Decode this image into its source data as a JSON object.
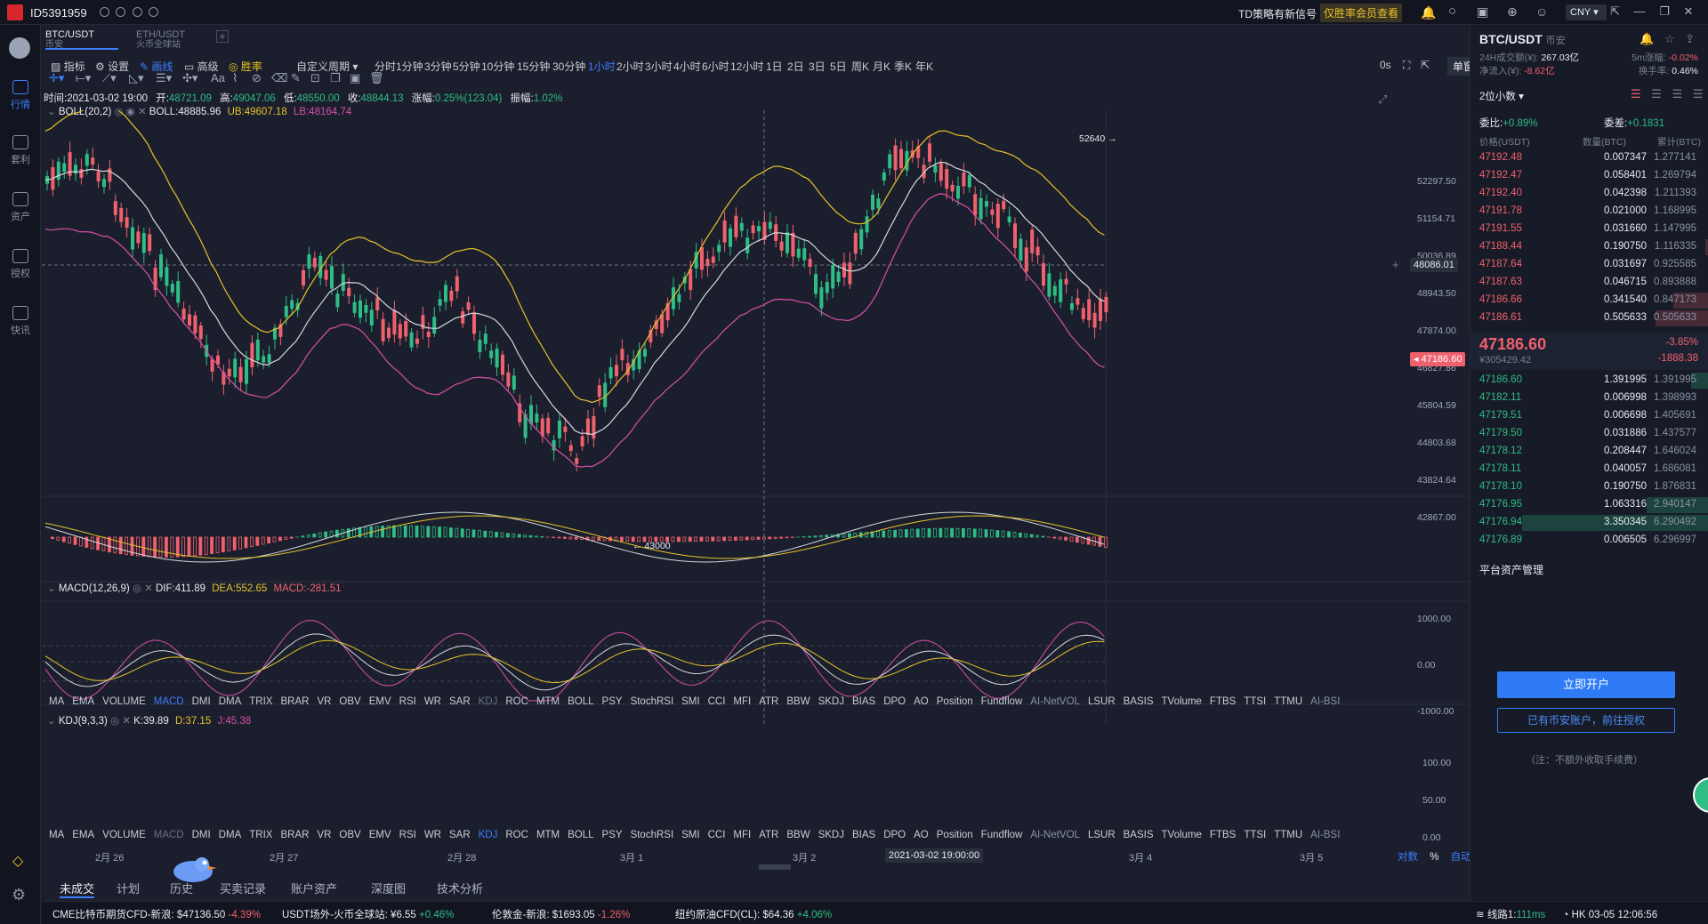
{
  "app": {
    "account_id": "ID5391959",
    "signal_text": "TD策略有新信号",
    "signal_link": "仅胜率会员查看",
    "currency": "CNY"
  },
  "nav": [
    {
      "label": "行情"
    },
    {
      "label": "套利"
    },
    {
      "label": "资产"
    },
    {
      "label": "授权"
    },
    {
      "label": "快讯"
    }
  ],
  "tabs": [
    {
      "title": "BTC/USDT",
      "sub": "币安"
    },
    {
      "title": "ETH/USDT",
      "sub": "火币全球站"
    }
  ],
  "toolbar": {
    "indicator": "指标",
    "settings": "设置",
    "draw": "画线",
    "advanced": "高级",
    "winrate": "胜率",
    "custom_period": "自定义周期",
    "periods": [
      "分时",
      "1分钟",
      "3分钟",
      "5分钟",
      "10分钟",
      "15分钟",
      "30分钟",
      "1小时",
      "2小时",
      "3小时",
      "4小时",
      "6小时",
      "12小时",
      "1日",
      "2日",
      "3日",
      "5日",
      "周K",
      "月K",
      "季K",
      "年K"
    ],
    "active_period": "1小时",
    "seconds": "0s",
    "window_mode": "单窗口"
  },
  "ohlc": {
    "time_label": "时间:",
    "time": "2021-03-02 19:00",
    "open_label": "开:",
    "open": "48721.09",
    "high_label": "高:",
    "high": "49047.06",
    "low_label": "低:",
    "low": "48550.00",
    "close_label": "收:",
    "close": "48844.13",
    "change_label": "涨幅:",
    "change": "0.25%(123.04)",
    "amp_label": "振幅:",
    "amp": "1.02%"
  },
  "boll": {
    "name": "BOLL(20,2)",
    "boll": "BOLL:48885.96",
    "ub": "UB:49607.18",
    "lb": "LB:48164.74"
  },
  "macd": {
    "name": "MACD(12,26,9)",
    "dif": "DIF:411.89",
    "dea": "DEA:552.65",
    "macd": "MACD:-281.51"
  },
  "kdj": {
    "name": "KDJ(9,3,3)",
    "k": "K:39.89",
    "d": "D:37.15",
    "j": "J:45.38"
  },
  "price_axis": [
    "52297.50",
    "51154.71",
    "50036.89",
    "48943.50",
    "47874.00",
    "46827.86",
    "45804.59",
    "44803.68",
    "43824.64",
    "42867.00"
  ],
  "crosshair_price": "48086.01",
  "last_price_tag": "47186.60",
  "high_mark": "52640",
  "low_mark": "43000",
  "macd_axis": [
    "1000.00",
    "0.00",
    "-1000.00"
  ],
  "kdj_axis": [
    "100.00",
    "50.00",
    "0.00"
  ],
  "indicator_list": [
    "MA",
    "EMA",
    "VOLUME",
    "MACD",
    "DMI",
    "DMA",
    "TRIX",
    "BRAR",
    "VR",
    "OBV",
    "EMV",
    "RSI",
    "WR",
    "SAR",
    "KDJ",
    "ROC",
    "MTM",
    "BOLL",
    "PSY",
    "StochRSI",
    "SMI",
    "CCI",
    "MFI",
    "ATR",
    "BBW",
    "SKDJ",
    "BIAS",
    "DPO",
    "AO",
    "Position",
    "Fundflow",
    "AI-NetVOL",
    "LSUR",
    "BASIS",
    "TVolume",
    "FTBS",
    "TTSI",
    "TTMU",
    "AI-BSI"
  ],
  "date_axis": [
    "2月 26",
    "2月 27",
    "2月 28",
    "3月 1",
    "3月 2",
    "3月 4",
    "3月 5"
  ],
  "crosshair_time": "2021-03-02 19:00:00",
  "axis_modes": [
    "对数",
    "%",
    "自动"
  ],
  "bottom_tabs": [
    "未成交",
    "计划",
    "历史",
    "买卖记录",
    "账户资产",
    "深度图",
    "技术分析"
  ],
  "ticker": [
    {
      "name": "CME比特币期货CFD-新浪:",
      "price": "$47136.50",
      "chg": "-4.39%",
      "dir": "down"
    },
    {
      "name": "USDT场外-火币全球站:",
      "price": "¥6.55",
      "chg": "+0.46%",
      "dir": "up"
    },
    {
      "name": "伦敦金-新浪:",
      "price": "$1693.05",
      "chg": "-1.26%",
      "dir": "down"
    },
    {
      "name": "纽约原油CFD(CL):",
      "price": "$64.36",
      "chg": "+4.06%",
      "dir": "up"
    }
  ],
  "connection": {
    "line": "线路1:",
    "ms": "111ms",
    "clock": "HK 03-05 12:06:56"
  },
  "panel": {
    "pair": "BTC/USDT",
    "exchange": "币安",
    "vol_label": "24H成交额(¥):",
    "vol": "267.03亿",
    "inflow_label": "净流入(¥):",
    "inflow": "-8.62亿",
    "amp5_label": "5m涨幅:",
    "amp5": "-0.02%",
    "turnover_label": "换手率:",
    "turnover": "0.46%",
    "decimals": "2位小数",
    "ratio_label": "委比:",
    "ratio": "+0.89%",
    "diff_label": "委差:",
    "diff": "+0.1831",
    "col_price": "价格(USDT)",
    "col_qty": "数量(BTC)",
    "col_cum": "累计(BTC)",
    "asks": [
      {
        "p": "47192.48",
        "q": "0.007347",
        "c": "1.277141",
        "w": 0
      },
      {
        "p": "47192.47",
        "q": "0.058401",
        "c": "1.269794",
        "w": 0
      },
      {
        "p": "47192.40",
        "q": "0.042398",
        "c": "1.211393",
        "w": 0
      },
      {
        "p": "47191.78",
        "q": "0.021000",
        "c": "1.168995",
        "w": 0
      },
      {
        "p": "47191.55",
        "q": "0.031660",
        "c": "1.147995",
        "w": 0
      },
      {
        "p": "47188.44",
        "q": "0.190750",
        "c": "1.116335",
        "w": 4
      },
      {
        "p": "47187.64",
        "q": "0.031697",
        "c": "0.925585",
        "w": 0
      },
      {
        "p": "47187.63",
        "q": "0.046715",
        "c": "0.893888",
        "w": 0
      },
      {
        "p": "47186.66",
        "q": "0.341540",
        "c": "0.847173",
        "w": 40
      },
      {
        "p": "47186.61",
        "q": "0.505633",
        "c": "0.505633",
        "w": 60
      }
    ],
    "last": "47186.60",
    "last_cny": "¥305429.42",
    "last_pct": "-3.85%",
    "last_chg": "-1888.38",
    "bids": [
      {
        "p": "47186.60",
        "q": "1.391995",
        "c": "1.391995",
        "w": 20
      },
      {
        "p": "47182.11",
        "q": "0.006998",
        "c": "1.398993",
        "w": 0
      },
      {
        "p": "47179.51",
        "q": "0.006698",
        "c": "1.405691",
        "w": 0
      },
      {
        "p": "47179.50",
        "q": "0.031886",
        "c": "1.437577",
        "w": 0
      },
      {
        "p": "47178.12",
        "q": "0.208447",
        "c": "1.646024",
        "w": 0
      },
      {
        "p": "47178.11",
        "q": "0.040057",
        "c": "1.686081",
        "w": 0
      },
      {
        "p": "47178.10",
        "q": "0.190750",
        "c": "1.876831",
        "w": 0
      },
      {
        "p": "47176.95",
        "q": "1.063316",
        "c": "2.940147",
        "w": 70
      },
      {
        "p": "47176.94",
        "q": "3.350345",
        "c": "6.290492",
        "w": 210
      },
      {
        "p": "47176.89",
        "q": "0.006505",
        "c": "6.296997",
        "w": 0
      }
    ],
    "platform": "平台资产管理",
    "open_account": "立即开户",
    "have_account": "已有币安账户，前往授权",
    "note": "（注：不额外收取手续费）"
  }
}
